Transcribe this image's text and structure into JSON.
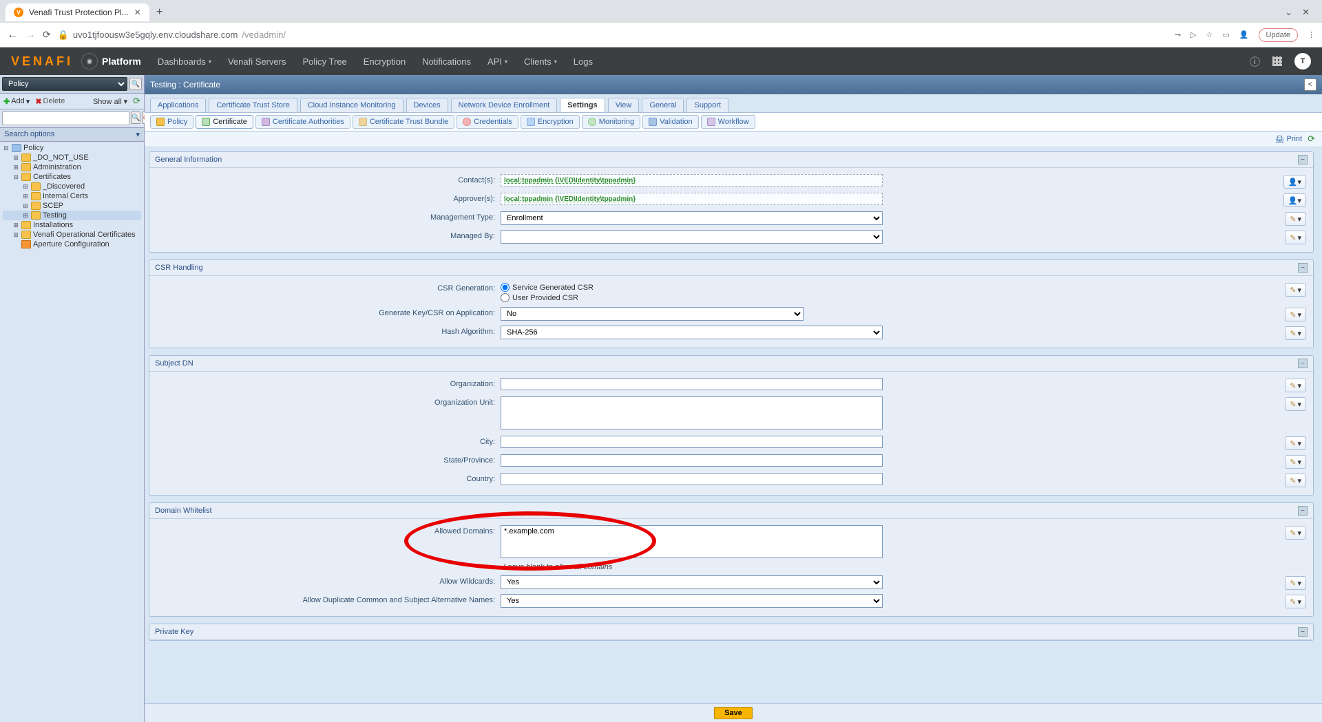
{
  "browser": {
    "tab_title": "Venafi Trust Protection Pl...",
    "url_host": "uvo1tjfoousw3e5gqly.env.cloudshare.com",
    "url_path": "/vedadmin/",
    "update_label": "Update"
  },
  "header": {
    "logo": "VENAFI",
    "platform": "Platform",
    "nav": [
      "Dashboards",
      "Venafi Servers",
      "Policy Tree",
      "Encryption",
      "Notifications",
      "API",
      "Clients",
      "Logs"
    ],
    "user_initial": "T"
  },
  "leftpane": {
    "selector": "Policy",
    "add": "Add",
    "delete": "Delete",
    "showall": "Show all",
    "search_options": "Search options",
    "tree": {
      "root": "Policy",
      "n0": "_DO_NOT_USE",
      "n1": "Administration",
      "n2": "Certificates",
      "n2a": "_Discovered",
      "n2b": "Internal Certs",
      "n2c": "SCEP",
      "n2d": "Testing",
      "n3": "Installations",
      "n4": "Venafi Operational Certificates",
      "n5": "Aperture Configuration"
    }
  },
  "breadcrumb": "Testing : Certificate",
  "section_tabs": [
    "Applications",
    "Certificate Trust Store",
    "Cloud Instance Monitoring",
    "Devices",
    "Network Device Enrollment",
    "Settings",
    "View",
    "General",
    "Support"
  ],
  "active_section_tab": "Settings",
  "sub_tabs": [
    "Policy",
    "Certificate",
    "Certificate Authorities",
    "Certificate Trust Bundle",
    "Credentials",
    "Encryption",
    "Monitoring",
    "Validation",
    "Workflow"
  ],
  "active_sub_tab": "Certificate",
  "print": "Print",
  "panels": {
    "general": {
      "title": "General Information",
      "contacts_lbl": "Contact(s):",
      "approvers_lbl": "Approver(s):",
      "identity_value": "local:tppadmin {\\VED\\Identity\\tppadmin}",
      "mgmt_type_lbl": "Management Type:",
      "mgmt_type_val": "Enrollment",
      "managed_by_lbl": "Managed By:",
      "managed_by_val": ""
    },
    "csr": {
      "title": "CSR Handling",
      "gen_lbl": "CSR Generation:",
      "radio1": "Service Generated CSR",
      "radio2": "User Provided CSR",
      "genkey_lbl": "Generate Key/CSR on Application:",
      "genkey_val": "No",
      "hash_lbl": "Hash Algorithm:",
      "hash_val": "SHA-256"
    },
    "dn": {
      "title": "Subject DN",
      "org_lbl": "Organization:",
      "ou_lbl": "Organization Unit:",
      "city_lbl": "City:",
      "state_lbl": "State/Province:",
      "country_lbl": "Country:"
    },
    "whitelist": {
      "title": "Domain Whitelist",
      "allowed_lbl": "Allowed Domains:",
      "allowed_val": "*.example.com",
      "hint": "Leave blank to allow all domains",
      "wildcards_lbl": "Allow Wildcards:",
      "wildcards_val": "Yes",
      "dup_lbl": "Allow Duplicate Common and Subject Alternative Names:",
      "dup_val": "Yes"
    },
    "pk": {
      "title": "Private Key"
    }
  },
  "save": "Save"
}
